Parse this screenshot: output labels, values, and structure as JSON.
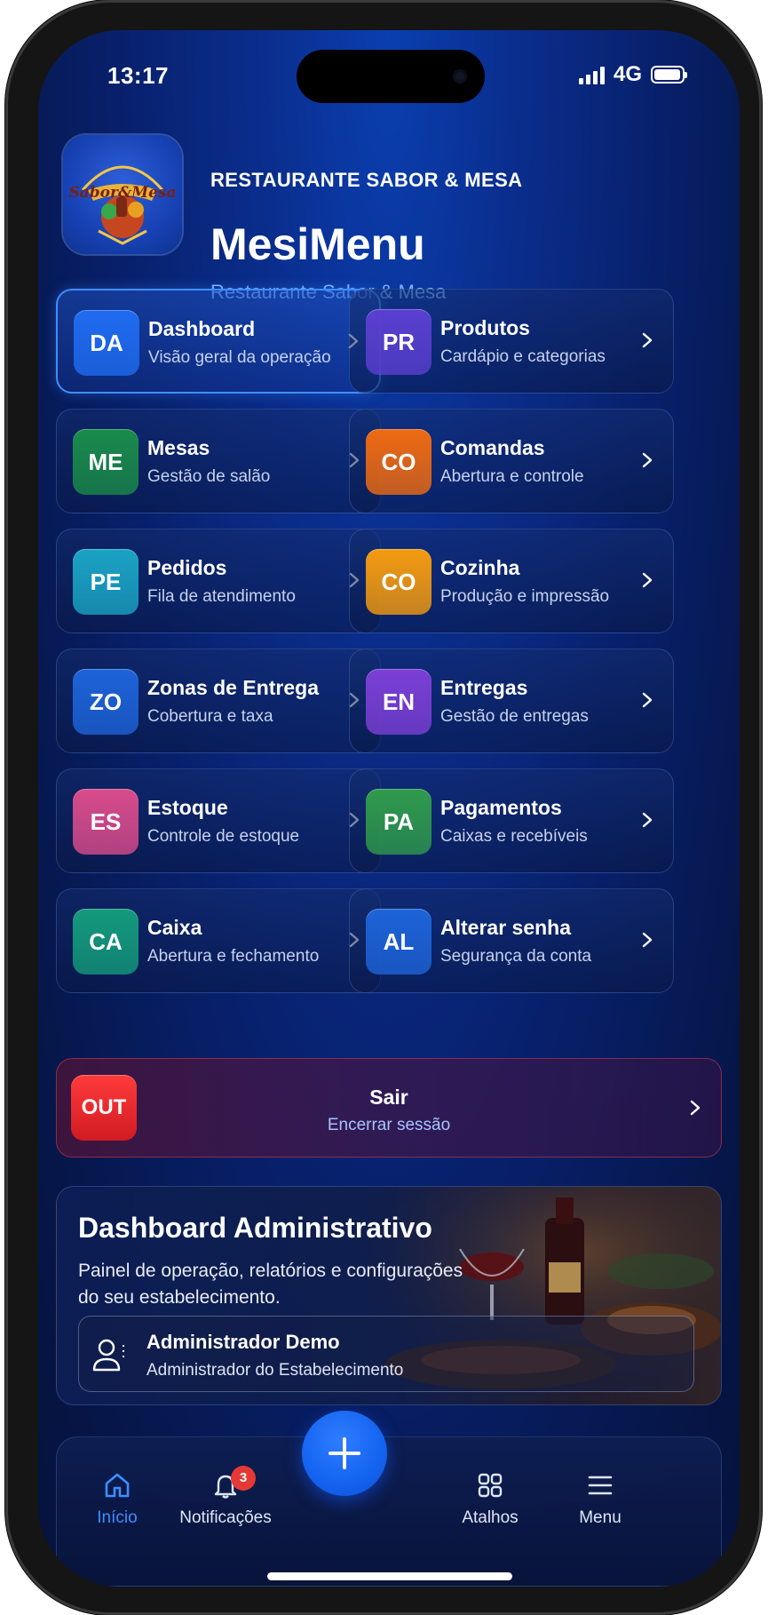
{
  "status_bar": {
    "time": "13:17",
    "network": "4G"
  },
  "header": {
    "logo_alt": "Restaurante Sabor & Mesa",
    "org_name": "RESTAURANTE SABOR & MESA",
    "app_title": "MesiMenu",
    "subtitle": "Restaurante Sabor & Mesa"
  },
  "menu": [
    {
      "badge": "DA",
      "title": "Dashboard",
      "desc": "Visão geral da operação",
      "color": "#1f6bf0",
      "active": true
    },
    {
      "badge": "PR",
      "title": "Produtos",
      "desc": "Cardápio e categorias",
      "color": "#5a3fd0"
    },
    {
      "badge": "ME",
      "title": "Mesas",
      "desc": "Gestão de salão",
      "color": "#1a8a4a"
    },
    {
      "badge": "CO",
      "title": "Comandas",
      "desc": "Abertura e controle",
      "color": "#ee6a12"
    },
    {
      "badge": "PE",
      "title": "Pedidos",
      "desc": "Fila de atendimento",
      "color": "#1aa3c4"
    },
    {
      "badge": "CO",
      "title": "Cozinha",
      "desc": "Produção e impressão",
      "color": "#f39a10"
    },
    {
      "badge": "ZO",
      "title": "Zonas de Entrega",
      "desc": "Cobertura e taxa",
      "color": "#1d63d8"
    },
    {
      "badge": "EN",
      "title": "Entregas",
      "desc": "Gestão de entregas",
      "color": "#7b3fd6"
    },
    {
      "badge": "ES",
      "title": "Estoque",
      "desc": "Controle de estoque",
      "color": "#d94b8c"
    },
    {
      "badge": "PA",
      "title": "Pagamentos",
      "desc": "Caixas e recebíveis",
      "color": "#2f9a4c"
    },
    {
      "badge": "CA",
      "title": "Caixa",
      "desc": "Abertura e fechamento",
      "color": "#149a7c"
    },
    {
      "badge": "AL",
      "title": "Alterar senha",
      "desc": "Segurança da conta",
      "color": "#1d63d8"
    }
  ],
  "logout": {
    "badge": "OUT",
    "title": "Sair",
    "desc": "Encerrar sessão",
    "color": "#e0242b"
  },
  "admin_card": {
    "title": "Dashboard Administrativo",
    "desc": "Painel de operação, relatórios e configurações do seu estabelecimento.",
    "user_name": "Administrador Demo",
    "user_role": "Administrador do Estabelecimento",
    "user_icon": "user-icon"
  },
  "tabbar": {
    "home": {
      "label": "Início",
      "icon": "home-icon"
    },
    "notifications": {
      "label": "Notificações",
      "icon": "bell-icon",
      "count": "3"
    },
    "fab": {
      "icon": "plus-icon"
    },
    "shortcuts": {
      "label": "Atalhos",
      "icon": "grid-icon"
    },
    "menu": {
      "label": "Menu",
      "icon": "hamburger-icon"
    }
  },
  "colors": {
    "accent": "#3f8eff",
    "background": "#0a2e8e",
    "danger": "#e0242b"
  }
}
